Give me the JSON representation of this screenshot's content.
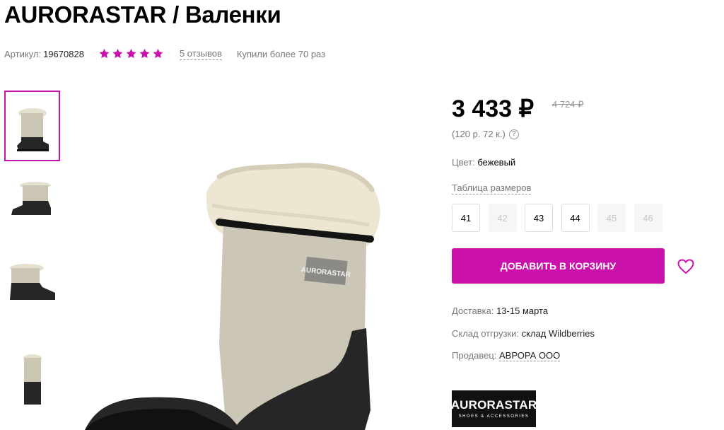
{
  "product": {
    "title": "AURORASTAR / Валенки",
    "sku_label": "Артикул:",
    "sku_value": "19670828",
    "rating": 5,
    "reviews": "5 отзывов",
    "bought": "Купили более 70 раз"
  },
  "pricing": {
    "price": "3 433 ₽",
    "old_price": "4 724 ₽",
    "unit_price": "(120 р. 72 к.)",
    "help_glyph": "?"
  },
  "color": {
    "label": "Цвет:",
    "value": "бежевый"
  },
  "size_table_link": "Таблица размеров",
  "sizes": [
    {
      "label": "41",
      "available": true
    },
    {
      "label": "42",
      "available": false
    },
    {
      "label": "43",
      "available": true
    },
    {
      "label": "44",
      "available": true
    },
    {
      "label": "45",
      "available": false
    },
    {
      "label": "46",
      "available": false
    }
  ],
  "cart_button": "ДОБАВИТЬ В КОРЗИНУ",
  "delivery": {
    "label": "Доставка:",
    "value": "13-15 марта"
  },
  "warehouse": {
    "label": "Склад отгрузки:",
    "value": "склад Wildberries"
  },
  "seller": {
    "label": "Продавец:",
    "value": "АВРОРА ООО"
  },
  "brand_logo": {
    "name": "AURORASTAR",
    "tagline": "SHOES & ACCESSORIES"
  },
  "boot_label": "AURORASTAR",
  "icons": {
    "star": "star-icon",
    "heart": "heart-icon",
    "help": "question-icon"
  },
  "colors": {
    "accent": "#cb11ab",
    "star": "#cb11ab"
  }
}
